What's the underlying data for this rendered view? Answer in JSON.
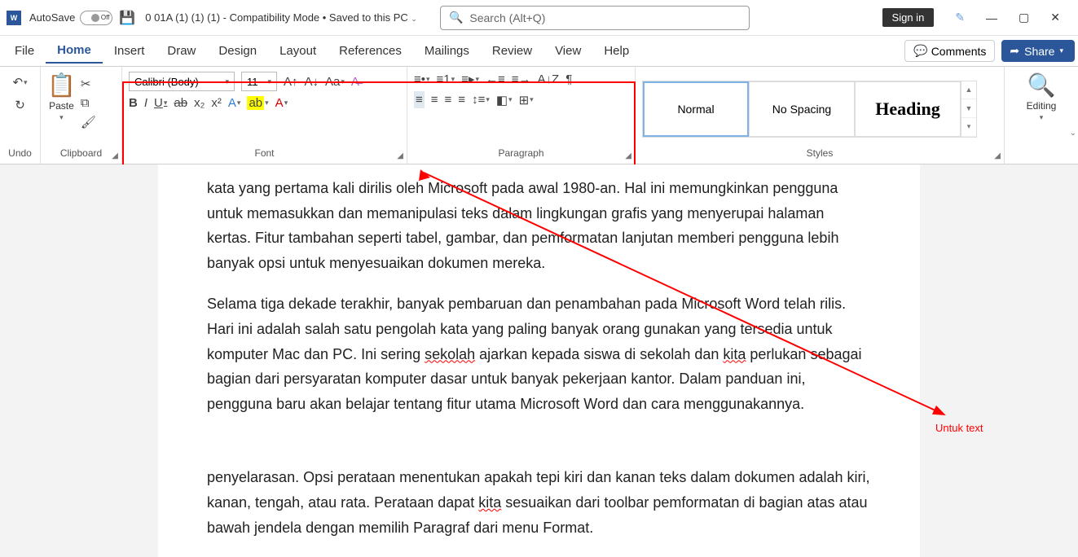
{
  "title": {
    "autosave": "AutoSave",
    "toggle": "Off",
    "doc": "0  01A (1) (1) (1)  -  Compatibility Mode • Saved to this PC",
    "search_placeholder": "Search (Alt+Q)",
    "signin": "Sign in"
  },
  "tabs": {
    "file": "File",
    "home": "Home",
    "insert": "Insert",
    "draw": "Draw",
    "design": "Design",
    "layout": "Layout",
    "references": "References",
    "mailings": "Mailings",
    "review": "Review",
    "view": "View",
    "help": "Help",
    "comments": "Comments",
    "share": "Share"
  },
  "ribbon": {
    "undo": "Undo",
    "clipboard": "Clipboard",
    "paste": "Paste",
    "font_group": "Font",
    "font_name": "Calibri (Body)",
    "font_size": "11",
    "paragraph_group": "Paragraph",
    "styles_group": "Styles",
    "editing": "Editing",
    "style_normal": "Normal",
    "style_nospacing": "No Spacing",
    "style_heading": "Heading"
  },
  "document": {
    "p1": "kata yang pertama kali dirilis oleh Microsoft pada awal 1980-an. Hal ini memungkinkan pengguna untuk memasukkan dan memanipulasi teks dalam lingkungan grafis yang menyerupai halaman kertas. Fitur tambahan seperti tabel, gambar, dan pemformatan lanjutan memberi pengguna lebih banyak opsi untuk menyesuaikan dokumen mereka.",
    "p2a": "Selama tiga dekade terakhir, banyak pembaruan dan penambahan pada Microsoft Word telah rilis. Hari ini adalah salah satu pengolah kata yang paling banyak orang gunakan yang tersedia untuk komputer Mac dan PC. Ini sering ",
    "p2b": "sekolah",
    "p2c": " ajarkan kepada siswa di sekolah dan ",
    "p2d": "kita",
    "p2e": " perlukan sebagai bagian dari persyaratan komputer dasar untuk banyak pekerjaan kantor. Dalam panduan ini, pengguna baru akan belajar tentang fitur utama Microsoft Word dan cara menggunakannya.",
    "p3a": "penyelarasan. Opsi perataan menentukan apakah tepi kiri dan kanan teks dalam dokumen adalah kiri, kanan, tengah, atau rata. Perataan dapat ",
    "p3b": "kita",
    "p3c": " sesuaikan dari toolbar pemformatan di bagian atas atau bawah jendela dengan memilih Paragraf dari menu Format."
  },
  "annotation": {
    "label": "Untuk text"
  }
}
